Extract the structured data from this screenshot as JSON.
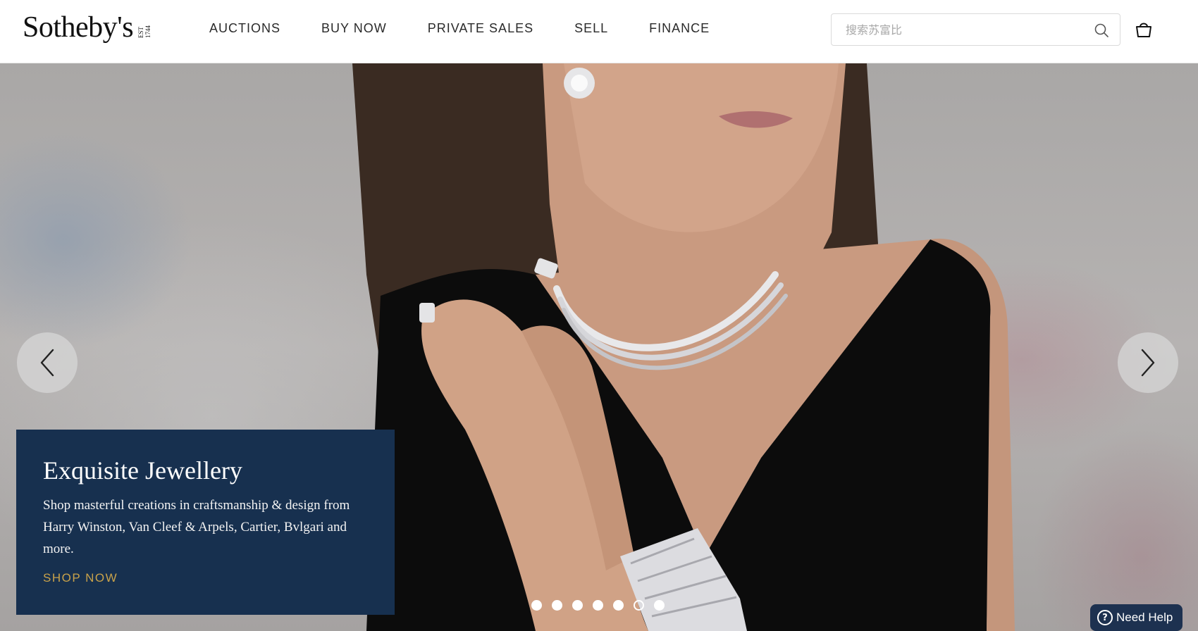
{
  "brand": {
    "name": "Sotheby's",
    "est_line1": "EST",
    "est_line2": "1744"
  },
  "nav": {
    "items": [
      {
        "label": "AUCTIONS"
      },
      {
        "label": "BUY NOW"
      },
      {
        "label": "PRIVATE SALES"
      },
      {
        "label": "SELL"
      },
      {
        "label": "FINANCE"
      }
    ]
  },
  "search": {
    "placeholder": "搜索苏富比",
    "value": ""
  },
  "icons": {
    "search": "search-icon",
    "cart": "shopping-bag-icon",
    "prev": "chevron-left-icon",
    "next": "chevron-right-icon",
    "help": "question-circle-icon"
  },
  "hero": {
    "title": "Exquisite Jewellery",
    "description": "Shop masterful creations in craftsmanship & design from Harry Winston, Van Cleef & Arpels, Cartier, Bvlgari and more.",
    "cta": "SHOP NOW",
    "slide_count": 7,
    "active_slide": 6
  },
  "help": {
    "label": "Need Help"
  },
  "colors": {
    "promo_bg": "#17304f",
    "cta": "#c9a24a",
    "help_bg": "#1d3150"
  }
}
